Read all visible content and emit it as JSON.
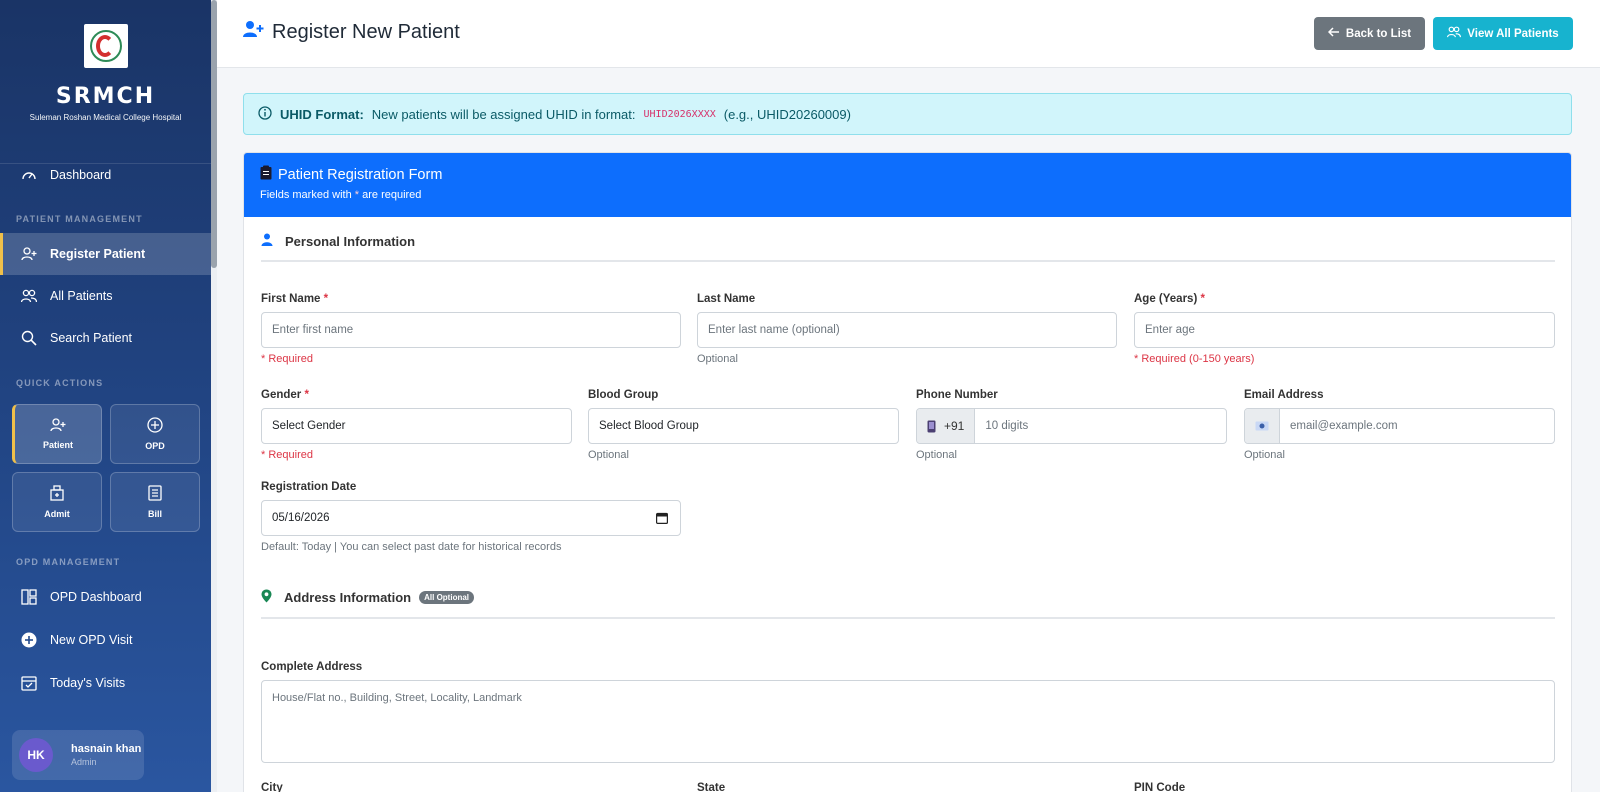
{
  "sidebar": {
    "brand_name": "SRMCH",
    "brand_sub": "Suleman Roshan Medical College Hospital",
    "dashboard": "Dashboard",
    "sec_patient": "PATIENT MANAGEMENT",
    "register_patient": "Register Patient",
    "all_patients": "All Patients",
    "search_patient": "Search Patient",
    "sec_quick": "QUICK ACTIONS",
    "quick": [
      "Patient",
      "OPD",
      "Admit",
      "Bill"
    ],
    "sec_opd": "OPD MANAGEMENT",
    "opd_dashboard": "OPD Dashboard",
    "new_opd_visit": "New OPD Visit",
    "todays_visits": "Today's Visits",
    "user": {
      "initials": "HK",
      "name": "hasnain khan",
      "role": "Admin"
    }
  },
  "header": {
    "title": "Register New Patient",
    "back_label": "Back to List",
    "all_label": "View All Patients"
  },
  "alert": {
    "strong": "UHID Format:",
    "text": "New patients will be assigned UHID in format:",
    "code": "UHID2026XXXX",
    "example": "(e.g., UHID20260009)"
  },
  "form": {
    "title": "Patient Registration Form",
    "sub_pre": "Fields marked with",
    "sub_star": "*",
    "sub_post": "are required",
    "personal_title": "Personal Information",
    "address_title": "Address Information",
    "address_badge": "All Optional",
    "first_name": {
      "label": "First Name",
      "placeholder": "Enter first name",
      "hint": "* Required"
    },
    "last_name": {
      "label": "Last Name",
      "placeholder": "Enter last name (optional)",
      "hint": "Optional"
    },
    "age": {
      "label": "Age (Years)",
      "placeholder": "Enter age",
      "hint": "* Required (0-150 years)"
    },
    "gender": {
      "label": "Gender",
      "value": "Select Gender",
      "hint": "* Required"
    },
    "blood": {
      "label": "Blood Group",
      "value": "Select Blood Group",
      "hint": "Optional"
    },
    "phone": {
      "label": "Phone Number",
      "prefix": "+91",
      "placeholder": "10 digits",
      "hint": "Optional"
    },
    "email": {
      "label": "Email Address",
      "placeholder": "email@example.com",
      "hint": "Optional"
    },
    "reg_date": {
      "label": "Registration Date",
      "value": "05/16/2026",
      "hint": "Default: Today | You can select past date for historical records"
    },
    "address": {
      "label": "Complete Address",
      "placeholder": "House/Flat no., Building, Street, Locality, Landmark"
    },
    "city_label": "City",
    "state_label": "State",
    "pin_label": "PIN Code"
  },
  "colors": {
    "primary": "#0d6efd",
    "info": "#17b3cf",
    "secondary": "#6c757d",
    "danger": "#dc3545"
  }
}
